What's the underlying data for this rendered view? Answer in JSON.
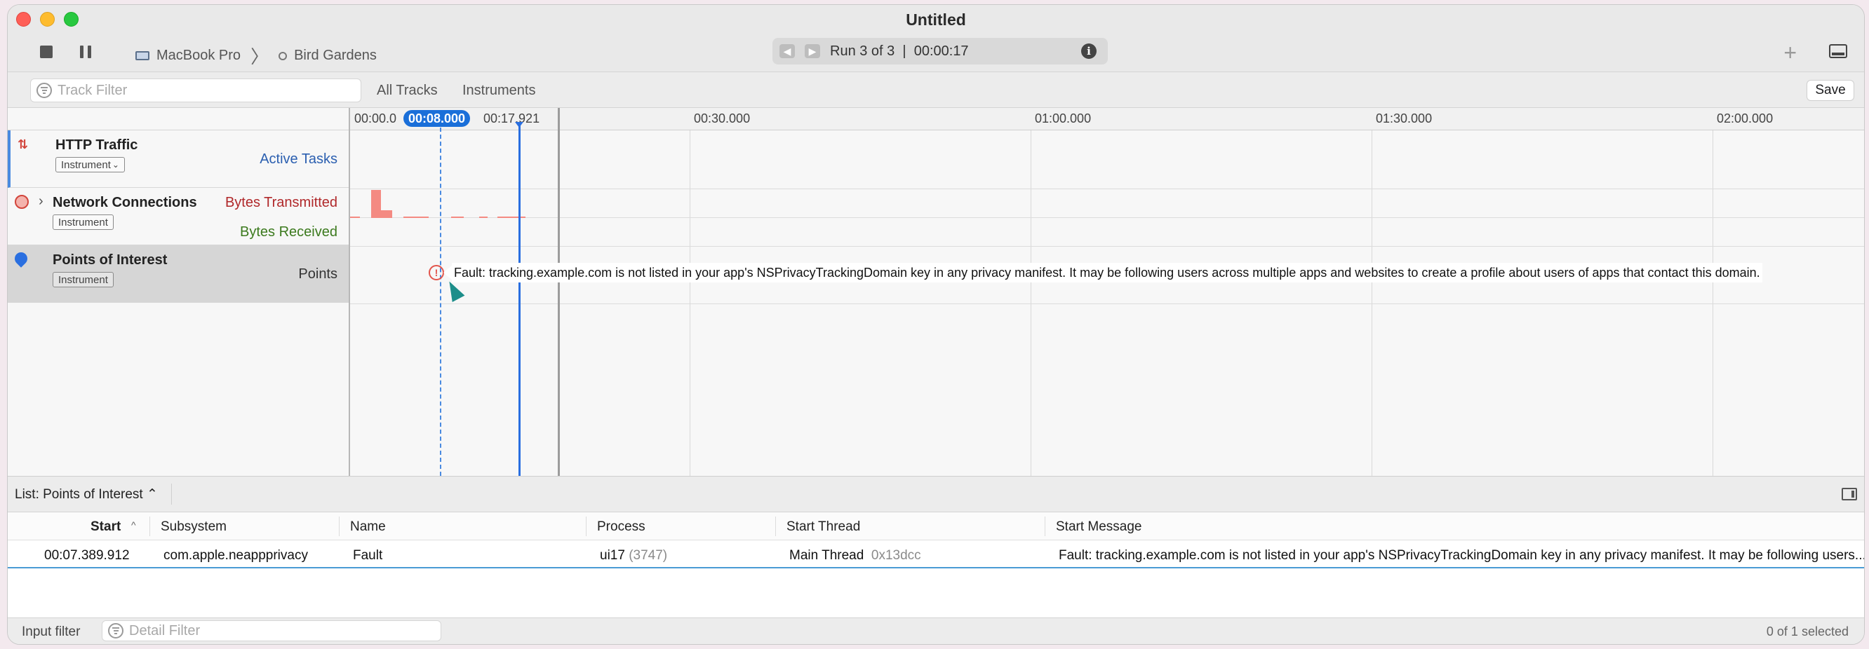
{
  "window": {
    "title": "Untitled"
  },
  "toolbar": {
    "device": "MacBook Pro",
    "target": "Bird Gardens",
    "run_status": "Run 3 of 3  |  00:00:17"
  },
  "filterbar": {
    "track_filter_placeholder": "Track Filter",
    "tab_all_tracks": "All Tracks",
    "tab_instruments": "Instruments",
    "save_label": "Save"
  },
  "ruler": {
    "labels": [
      "00:00.0",
      "00:17.921",
      "00:30.000",
      "01:00.000",
      "01:30.000",
      "02:00.000"
    ],
    "playhead": "00:08.000"
  },
  "tracks": [
    {
      "name": "HTTP Traffic",
      "badge": "Instrument",
      "details": [
        "Active Tasks"
      ]
    },
    {
      "name": "Network Connections",
      "badge": "Instrument",
      "details": [
        "Bytes Transmitted",
        "Bytes Received"
      ]
    },
    {
      "name": "Points of Interest",
      "badge": "Instrument",
      "details": [
        "Points"
      ]
    }
  ],
  "tooltip": "Fault: tracking.example.com is not listed in your app's NSPrivacyTrackingDomain key in any privacy manifest. It may be following users across multiple apps and websites to create a profile about users of apps that contact this domain.",
  "list": {
    "selector": "List: Points of Interest ⌃",
    "columns": [
      "Start",
      "Subsystem",
      "Name",
      "Process",
      "Start Thread",
      "Start Message"
    ],
    "rows": [
      {
        "start": "00:07.389.912",
        "subsystem": "com.apple.neappprivacy",
        "name": "Fault",
        "process": "ui17",
        "pid": "(3747)",
        "thread": "Main Thread",
        "thread_id": "0x13dcc",
        "message": "Fault: tracking.example.com is not listed in your app's NSPrivacyTrackingDomain key in any privacy manifest. It may be following users..."
      }
    ]
  },
  "statusbar": {
    "input_filter": "Input filter",
    "detail_filter_placeholder": "Detail Filter",
    "selection": "0 of 1 selected"
  },
  "colors": {
    "accent": "#1a6fd9",
    "bytes_transmitted": "#b0282a",
    "bytes_received": "#3c7a1e",
    "active_tasks": "#2b5fb0",
    "fault": "#e2554c"
  }
}
